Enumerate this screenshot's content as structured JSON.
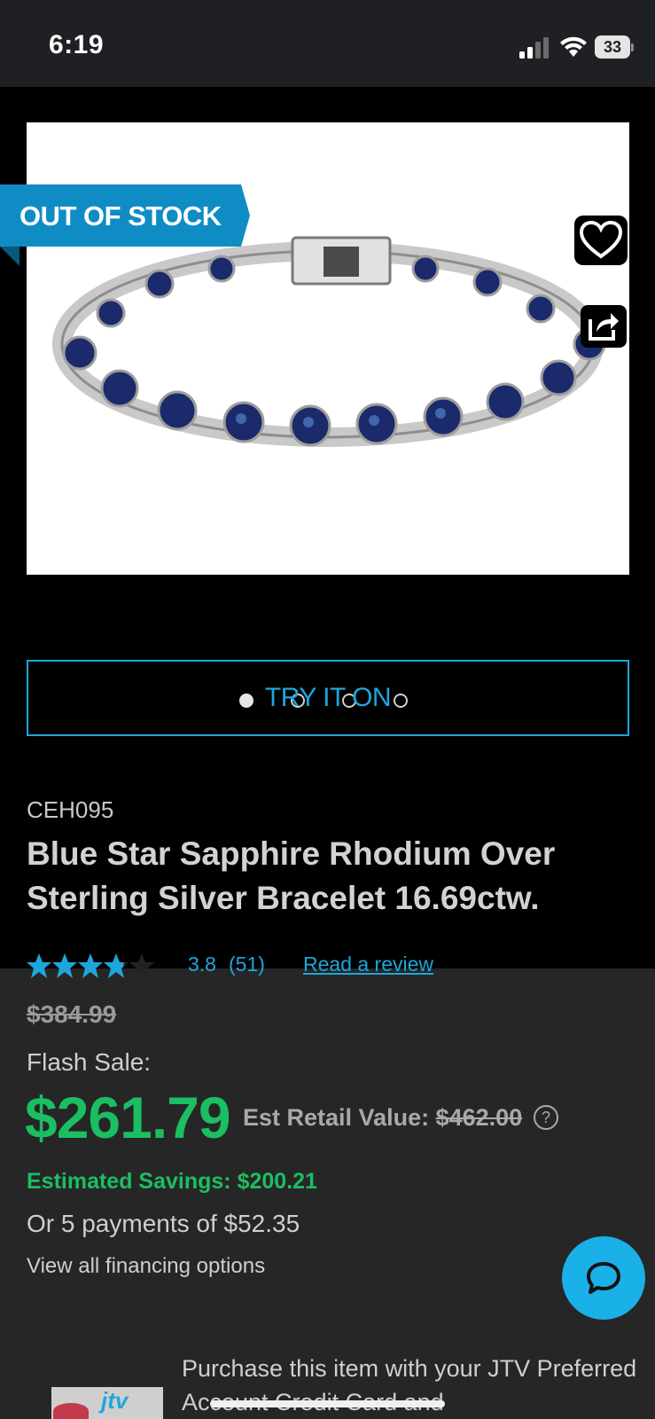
{
  "status_bar": {
    "time": "6:19",
    "battery": "33"
  },
  "product": {
    "badge": "OUT OF STOCK",
    "image_alt": "Blue star sapphire tennis bracelet",
    "carousel": {
      "count": 4,
      "active_index": 0
    },
    "try_on_label": "TRY IT ON",
    "sku": "CEH095",
    "title": "Blue Star Sapphire Rhodium Over Sterling Silver Bracelet 16.69ctw.",
    "rating": {
      "value": "3.8",
      "count": "(51)",
      "stars_filled": 3.8,
      "stars_total": 5,
      "read_review_label": "Read a review"
    },
    "old_price": "$384.99",
    "flash_sale_label": "Flash Sale:",
    "sale_price": "$261.79",
    "est_retail_label": "Est Retail Value:",
    "est_retail_value": "$462.00",
    "help_symbol": "?",
    "savings": "Estimated Savings: $200.21",
    "payments": "Or 5 payments of $52.35",
    "financing_link": "View all financing options",
    "promo_text": "Purchase this item with your JTV Preferred Account Credit Card and",
    "card_logo_text": "jtv"
  },
  "colors": {
    "accent_blue": "#1ea6dc",
    "sale_green": "#1bbe62",
    "panel_gray": "#262626"
  },
  "icons": [
    "heart-icon",
    "share-icon",
    "chat-icon",
    "star-icon",
    "help-icon",
    "wifi-icon",
    "signal-icon",
    "battery-icon"
  ]
}
